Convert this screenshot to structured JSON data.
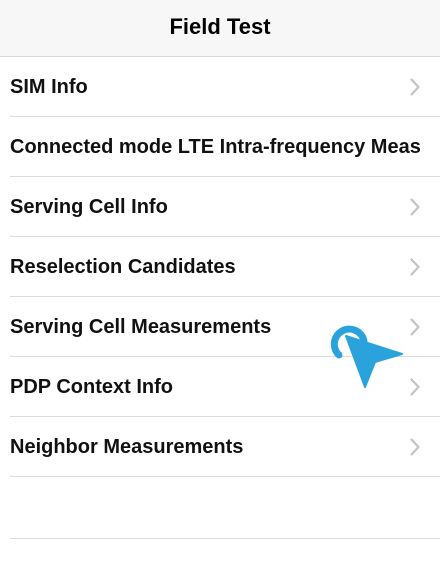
{
  "header": {
    "title": "Field Test"
  },
  "menu": {
    "items": [
      {
        "label": "SIM Info"
      },
      {
        "label": "Connected mode LTE Intra-frequency Meas"
      },
      {
        "label": "Serving Cell Info"
      },
      {
        "label": "Reselection Candidates"
      },
      {
        "label": "Serving Cell Measurements"
      },
      {
        "label": "PDP Context Info"
      },
      {
        "label": "Neighbor Measurements"
      }
    ]
  },
  "icons": {
    "chevron": "chevron-right-icon",
    "cursor": "tap-cursor-icon"
  },
  "colors": {
    "accent": "#2aa3dd",
    "chevron": "#c4c4c8",
    "separator": "#dcdcdc"
  }
}
